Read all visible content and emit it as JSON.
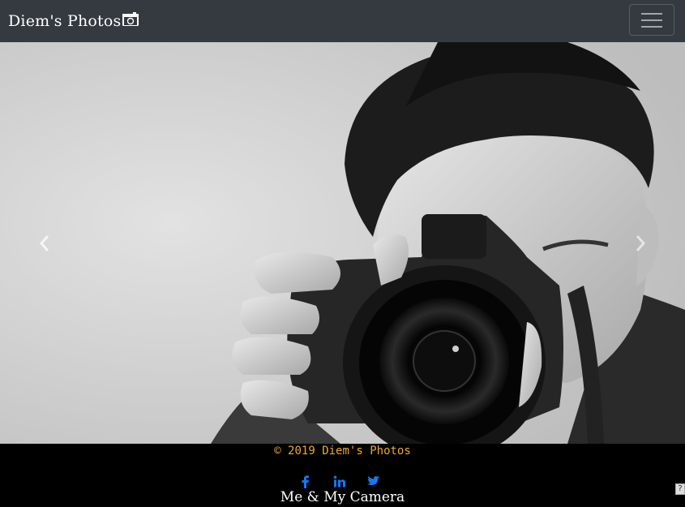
{
  "navbar": {
    "brand": "Diem's Photos",
    "brand_icon": "camera-icon",
    "toggler_icon": "hamburger-icon"
  },
  "carousel": {
    "slide_image": "photographer-with-dslr-camera",
    "prev_icon": "chevron-left-icon",
    "next_icon": "chevron-right-icon"
  },
  "footer": {
    "copyright": "© 2019 Diem's Photos",
    "socials": [
      "facebook-icon",
      "linkedin-icon",
      "twitter-icon"
    ],
    "tagline": "Me & My Camera",
    "accent_color": "#f0a830",
    "social_color": "#1877f2"
  },
  "help_badge": "?"
}
